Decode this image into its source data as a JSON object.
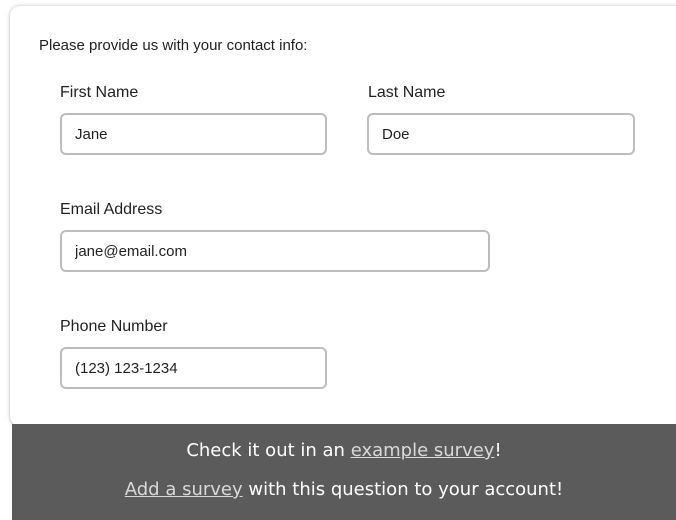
{
  "form": {
    "prompt": "Please provide us with your contact info:",
    "first_name": {
      "label": "First Name",
      "value": "Jane"
    },
    "last_name": {
      "label": "Last Name",
      "value": "Doe"
    },
    "email": {
      "label": "Email Address",
      "value": "jane@email.com"
    },
    "phone": {
      "label": "Phone Number",
      "value": "(123) 123-1234"
    }
  },
  "footer": {
    "line1_prefix": "Check it out in an ",
    "line1_link": "example survey",
    "line1_suffix": "!",
    "line2_link": "Add a survey",
    "line2_suffix": " with this question to your account!"
  }
}
